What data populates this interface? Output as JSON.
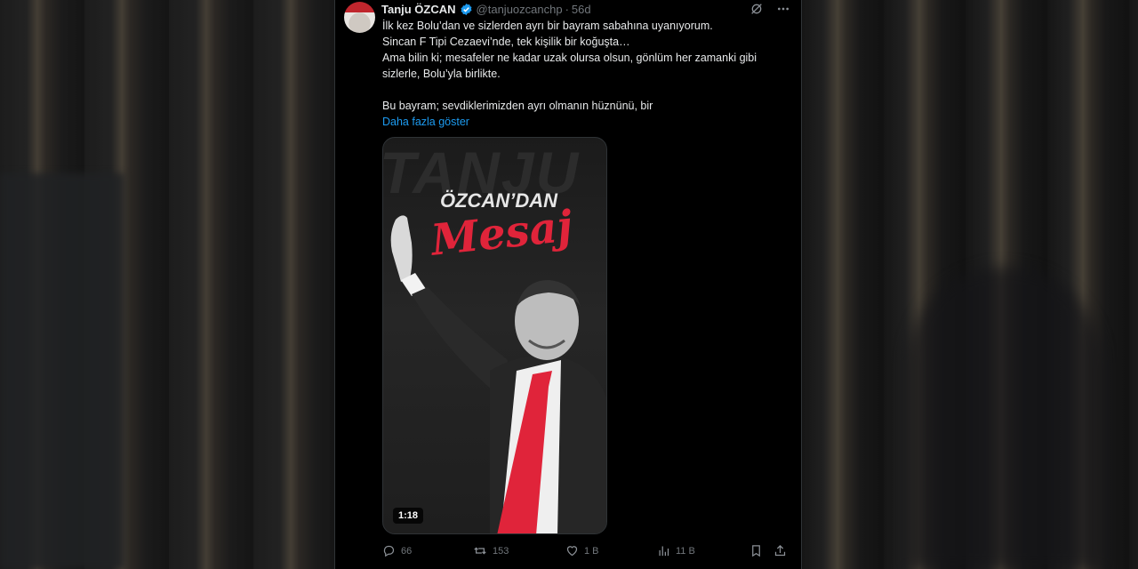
{
  "tweet": {
    "author_name": "Tanju ÖZCAN",
    "handle": "@tanjuozcanchp",
    "separator": "·",
    "time": "56d",
    "lines": [
      "İlk kez Bolu’dan ve sizlerden ayrı bir bayram sabahına uyanıyorum.",
      "Sincan F Tipi Cezaevi’nde, tek kişilik bir koğuşta…",
      "Ama bilin ki; mesafeler ne kadar uzak olursa olsun, gönlüm her zamanki gibi",
      "sizlerle, Bolu’yla birlikte.",
      "Bu bayram; sevdiklerimizden ayrı olmanın hüznünü, bir"
    ],
    "show_more": "Daha fazla göster"
  },
  "media": {
    "watermark": "TANJU",
    "title_top": "ÖZCAN’DAN",
    "title_script": "Mesaj",
    "duration": "1:18",
    "accent_color": "#e0243a"
  },
  "actions": {
    "replies": "66",
    "reposts": "153",
    "likes": "1 B",
    "views": "11 B"
  },
  "icons": [
    "verified-icon",
    "grok-icon",
    "more-icon",
    "reply-icon",
    "repost-icon",
    "like-icon",
    "views-icon",
    "bookmark-icon",
    "share-icon"
  ]
}
